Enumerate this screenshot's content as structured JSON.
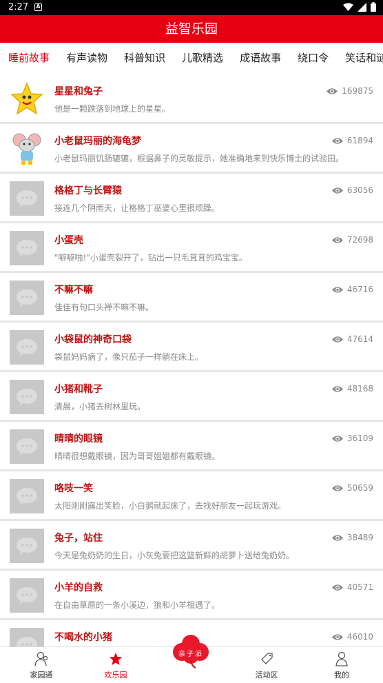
{
  "status": {
    "time": "2:27",
    "notif_glyph": "A"
  },
  "appbar": {
    "title": "益智乐园"
  },
  "tabs": [
    "睡前故事",
    "有声读物",
    "科普知识",
    "儿歌精选",
    "成语故事",
    "绕口令",
    "笑话和谜语"
  ],
  "active_tab": 0,
  "items": [
    {
      "title": "星星和兔子",
      "desc": "他是一颗跌落到地球上的星星。",
      "views": "169875",
      "thumb": "star"
    },
    {
      "title": "小老鼠玛丽的海龟梦",
      "desc": "小老鼠玛丽饥肠辘辘，根据鼻子的灵敏提示，她准确地来到快乐博士的试验田。",
      "views": "61894",
      "thumb": "mouse"
    },
    {
      "title": "格格丁与长臂猿",
      "desc": "接连几个阴雨天，让格格丁巫婆心里很烦躁。",
      "views": "63056",
      "thumb": "placeholder"
    },
    {
      "title": "小蛋壳",
      "desc": "\"噼噼啪!\"小蛋壳裂开了，钻出一只毛茸茸的鸡宝宝。",
      "views": "72698",
      "thumb": "placeholder"
    },
    {
      "title": "不嘛不嘛",
      "desc": "佳佳有句口头禅不嘛不嘛。",
      "views": "46716",
      "thumb": "placeholder"
    },
    {
      "title": "小袋鼠的神奇口袋",
      "desc": "袋鼠妈妈病了，像只茄子一样躺在床上。",
      "views": "47614",
      "thumb": "placeholder"
    },
    {
      "title": "小猪和靴子",
      "desc": "清晨，小猪去树林里玩。",
      "views": "48168",
      "thumb": "placeholder"
    },
    {
      "title": "晴晴的眼镜",
      "desc": "晴晴很想戴眼镜，因为哥哥姐姐都有戴眼镜。",
      "views": "36109",
      "thumb": "placeholder"
    },
    {
      "title": "咯吱一笑",
      "desc": "太阳刚刚露出笑脸，小白鹅就起床了，去找好朋友一起玩游戏。",
      "views": "50659",
      "thumb": "placeholder"
    },
    {
      "title": "兔子，站住",
      "desc": "今天是兔奶奶的生日，小灰兔要把这篮新鲜的胡萝卜送给兔奶奶。",
      "views": "38489",
      "thumb": "placeholder"
    },
    {
      "title": "小羊的自救",
      "desc": "在自由草原的一条小溪边，狼和小羊相遇了。",
      "views": "40571",
      "thumb": "placeholder"
    },
    {
      "title": "不喝水的小猪",
      "desc": "",
      "views": "46010",
      "thumb": "placeholder"
    }
  ],
  "nav": {
    "home": "家园通",
    "fun": "欢乐园",
    "logo": "亲子派",
    "activity": "活动区",
    "me": "我的"
  },
  "colors": {
    "accent": "#e60012",
    "title_red": "#c01414"
  }
}
